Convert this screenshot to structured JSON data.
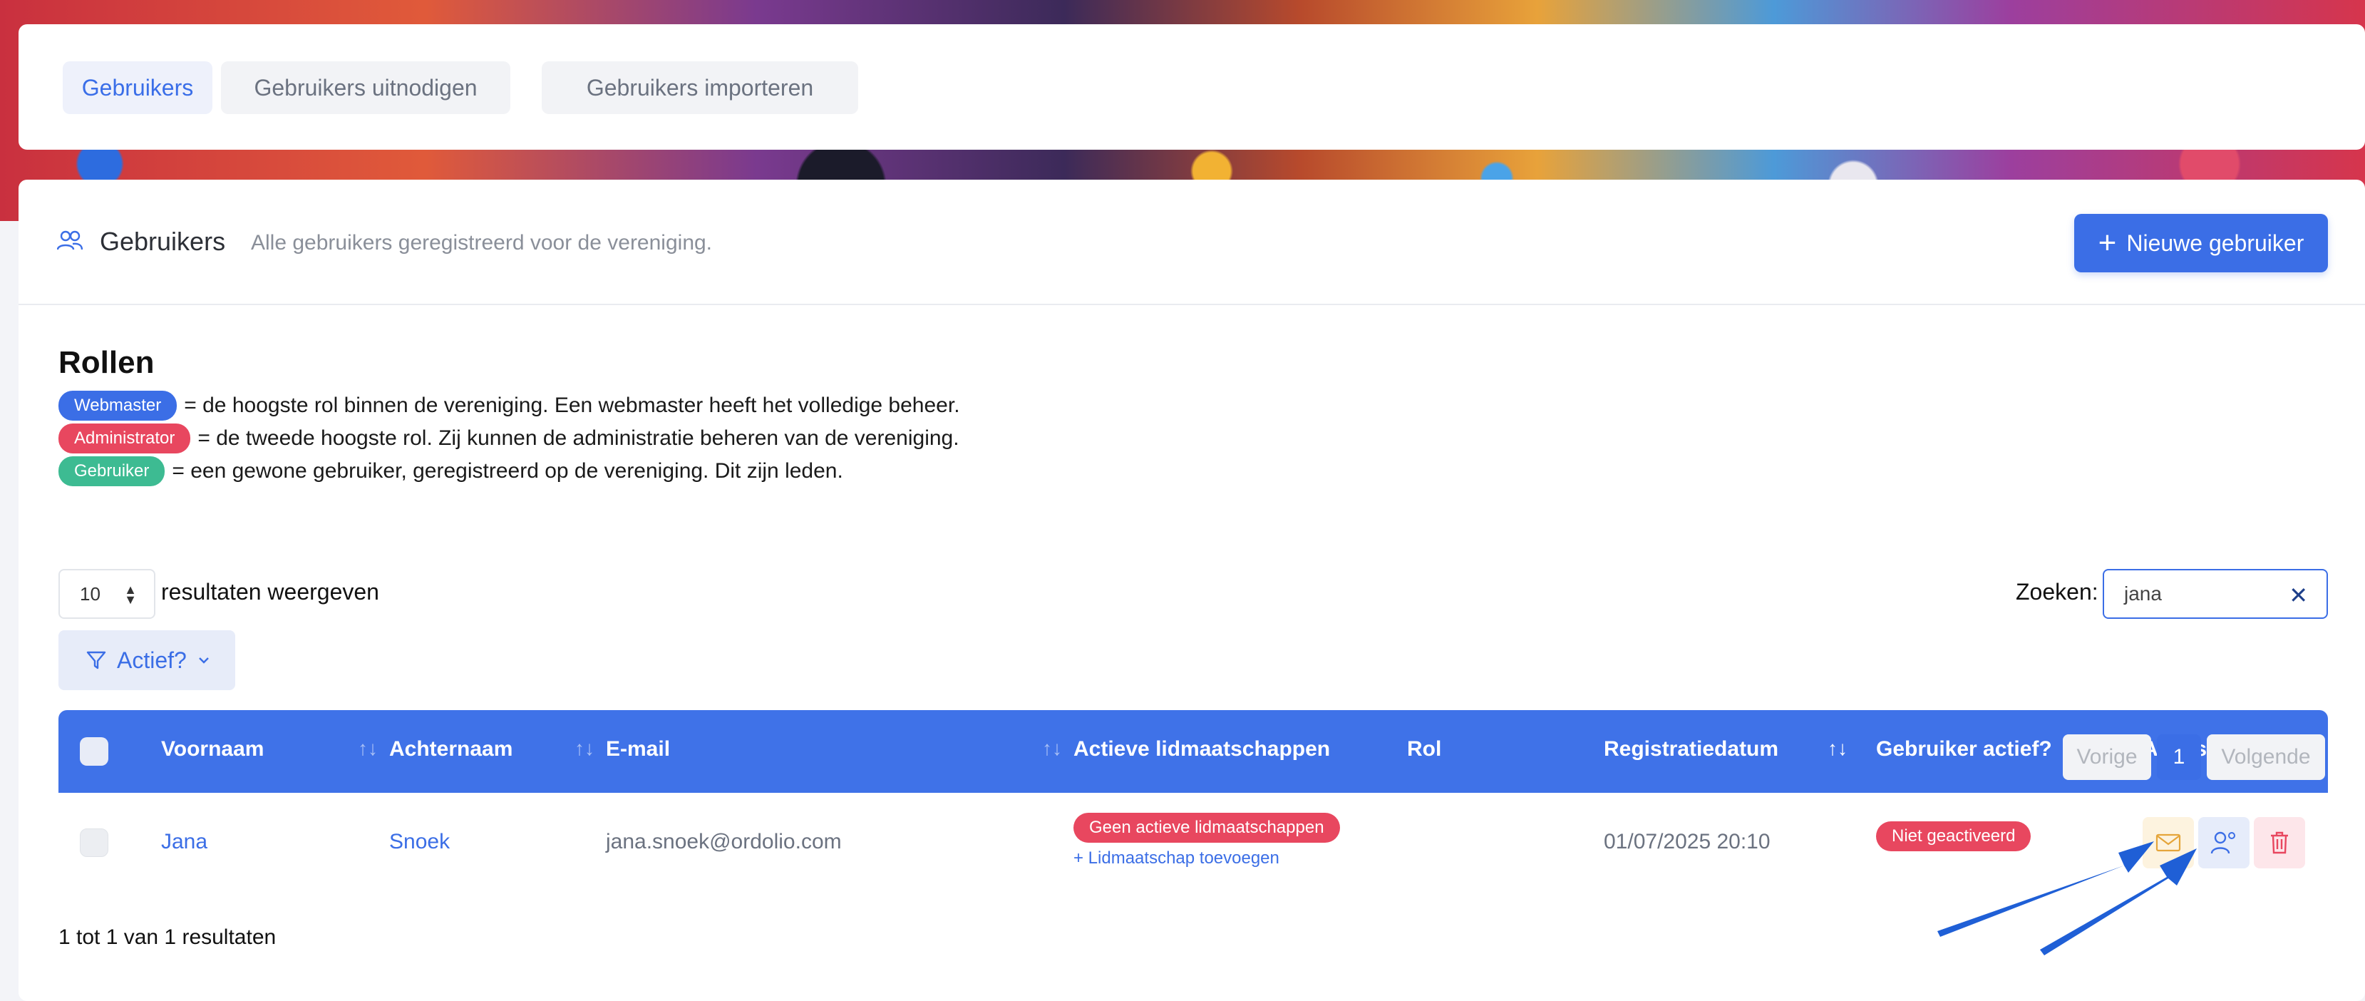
{
  "tabs": [
    {
      "label": "Gebruikers",
      "active": true
    },
    {
      "label": "Gebruikers uitnodigen",
      "active": false
    },
    {
      "label": "Gebruikers importeren",
      "active": false
    }
  ],
  "header": {
    "title": "Gebruikers",
    "subtitle": "Alle gebruikers geregistreerd voor de vereniging.",
    "new_button": "Nieuwe gebruiker"
  },
  "roles": {
    "title": "Rollen",
    "items": [
      {
        "badge": "Webmaster",
        "color": "#3b6ee6",
        "text": "= de hoogste rol binnen de vereniging. Een webmaster heeft het volledige beheer."
      },
      {
        "badge": "Administrator",
        "color": "#e8475f",
        "text": "= de tweede hoogste rol. Zij kunnen de administratie beheren van de vereniging."
      },
      {
        "badge": "Gebruiker",
        "color": "#3dbb92",
        "text": "= een gewone gebruiker, geregistreerd op de vereniging. Dit zijn leden."
      }
    ]
  },
  "controls": {
    "page_length": "10",
    "page_length_label": "resultaten weergeven",
    "search_label": "Zoeken:",
    "search_value": "jana",
    "filter_label": "Actief?"
  },
  "table": {
    "columns": [
      "Voornaam",
      "Achternaam",
      "E-mail",
      "Actieve lidmaatschappen",
      "Rol",
      "Registratiedatum",
      "Gebruiker actief?",
      "Acties"
    ],
    "rows": [
      {
        "voornaam": "Jana",
        "achternaam": "Snoek",
        "email": "jana.snoek@ordolio.com",
        "lidmaatschap_badge": "Geen actieve lidmaatschappen",
        "lidmaatschap_link": "+ Lidmaatschap toevoegen",
        "rol": "",
        "registratiedatum": "01/07/2025 20:10",
        "actief": "Niet geactiveerd"
      }
    ]
  },
  "footer": {
    "info": "1 tot 1 van 1 resultaten",
    "prev": "Vorige",
    "page": "1",
    "next": "Volgende"
  },
  "colors": {
    "accent": "#3b6ee6",
    "danger": "#e8475f",
    "success": "#3dbb92"
  }
}
